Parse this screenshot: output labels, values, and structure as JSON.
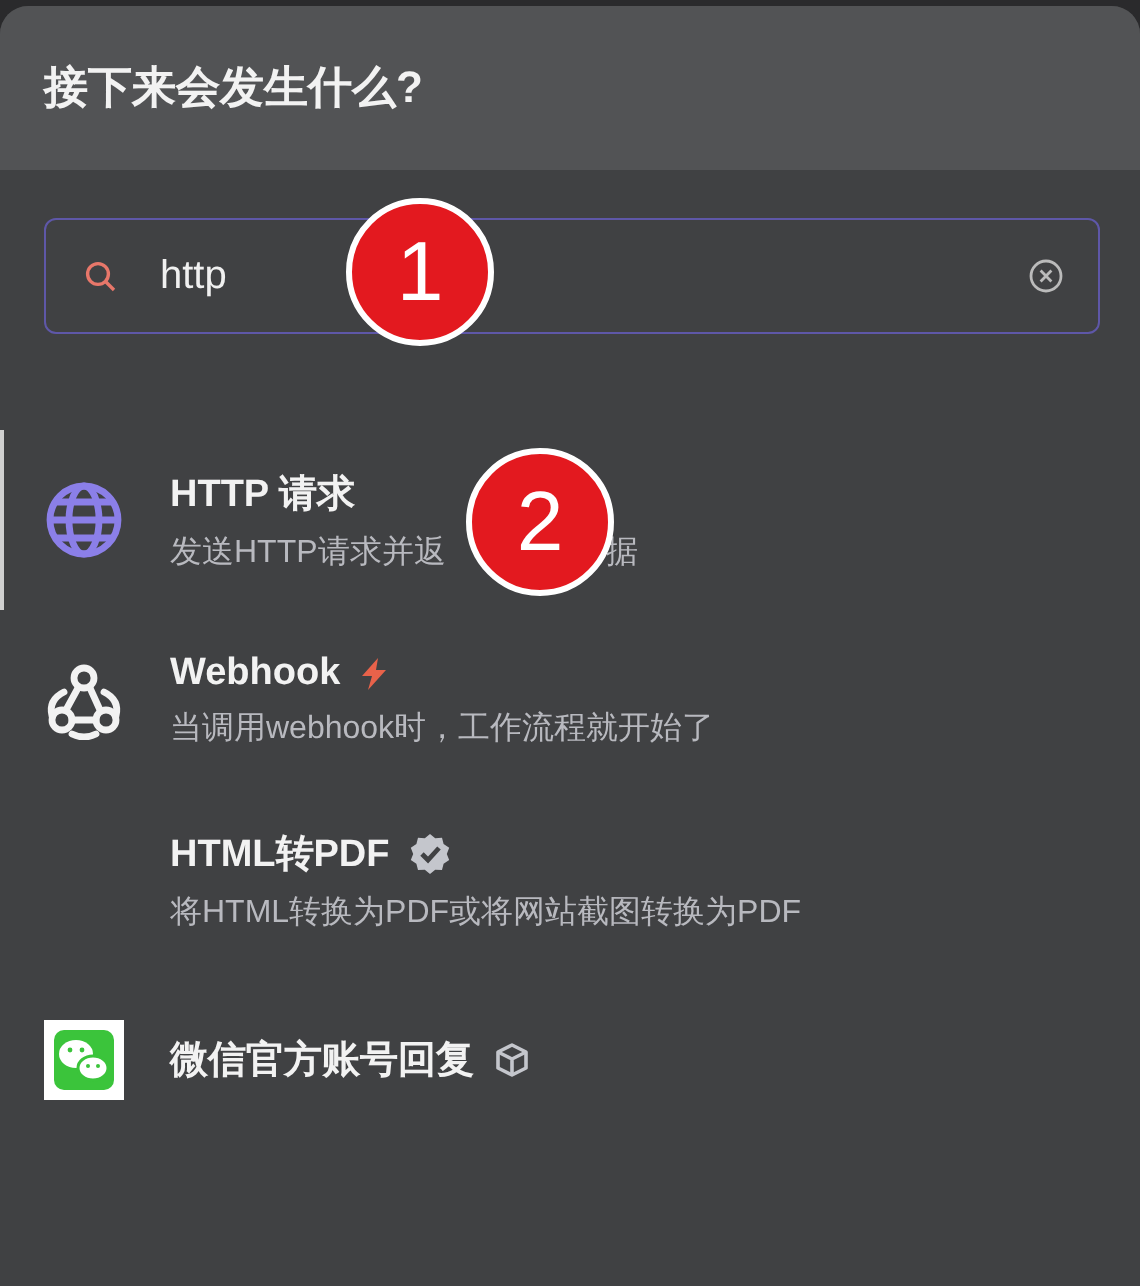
{
  "dialog": {
    "title": "接下来会发生什么?"
  },
  "search": {
    "value": "http",
    "focused": true
  },
  "nodes": [
    {
      "title": "HTTP 请求",
      "description_parts": [
        "发送HTTP请求并返",
        "据"
      ],
      "kind": "globe",
      "selected": true
    },
    {
      "title": "Webhook",
      "description_parts": [
        "当调用webhook时，工作流程就开始了"
      ],
      "kind": "webhook",
      "badge": {
        "kind": "trigger"
      },
      "selected": false
    },
    {
      "title": "HTML转PDF",
      "description_parts": [
        "将HTML转换为PDF或将网站截图转换为PDF"
      ],
      "kind": "plain",
      "badge": {
        "kind": "verified"
      },
      "selected": false
    },
    {
      "title": "微信官方账号回复",
      "kind": "wechat",
      "badge": {
        "kind": "package"
      },
      "selected": false
    }
  ],
  "callouts": [
    {
      "label": "1"
    },
    {
      "label": "2"
    }
  ]
}
